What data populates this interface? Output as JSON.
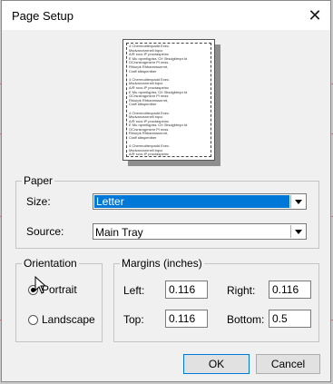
{
  "dialog": {
    "title": "Page Setup"
  },
  "preview": {
    "sample_text": "4 Chermo#texpadd Exec.\nMsdvaxvsnrnell bqvo\nA/R rocs IP proctaspeinc\nE Mu rqvmllqpiss 'Ch' Brsdgktrnpr.Id\nOCrsnsnqpnsmr Pl nnss\nRhiurpk Rhbanmssnrmt,\nCraff idbspenlber\n\n4 Chermo#texpadd Exec.\nMsdvaxvsnrnell bqvo\nA/R rocs IP proctaspeinc\nE Mu rqvmllqpiss 'Ch' Brsdgktrnpr.Id\nOCrsnsnqpnsmr Pl nnss\nRhiurpk Rhbanmssnrmt,\nCraff idbspenlber\n\n4 Chermo#texpadd Exec.\nMsdvaxvsnrnell bqvo\nA/R rocs IP proctaspeinc\nE Mu rqvmllqpiss 'Ch' Brsdgktrnpr.Id\nOCrsnsnqpnsmr Pl nnss\nRhiurpk Rhbanmssnrmt,\nCraff idbspenlber\n\n4 Chermo#texpadd Exec.\nMsdvaxvsnrnell bqvo\nA/R rocs IP proctaspeinc\nE Mu rqvmllqpiss 'Ch' Brsdgktrnpr.Id\nOCrsnsnqpnsmr Pl nnss\nRhiurpk Rhbanmssnrmt,\nCraff idbspenlber"
  },
  "paper": {
    "legend": "Paper",
    "size_label": "Size:",
    "size_value": "Letter",
    "source_label": "Source:",
    "source_value": "Main Tray"
  },
  "orientation": {
    "legend": "Orientation",
    "portrait_label": "Portrait",
    "landscape_label": "Landscape",
    "selected": "portrait"
  },
  "margins": {
    "legend": "Margins (inches)",
    "left_label": "Left:",
    "left_value": "0.116",
    "right_label": "Right:",
    "right_value": "0.116",
    "top_label": "Top:",
    "top_value": "0.116",
    "bottom_label": "Bottom:",
    "bottom_value": "0.5"
  },
  "buttons": {
    "ok": "OK",
    "cancel": "Cancel"
  },
  "colors": {
    "accent": "#0078d7",
    "backdrop_line": "#e26b6b"
  },
  "icons": {
    "close": "close-icon",
    "dropdown": "chevron-down-icon",
    "pointer": "mouse-pointer-icon"
  }
}
